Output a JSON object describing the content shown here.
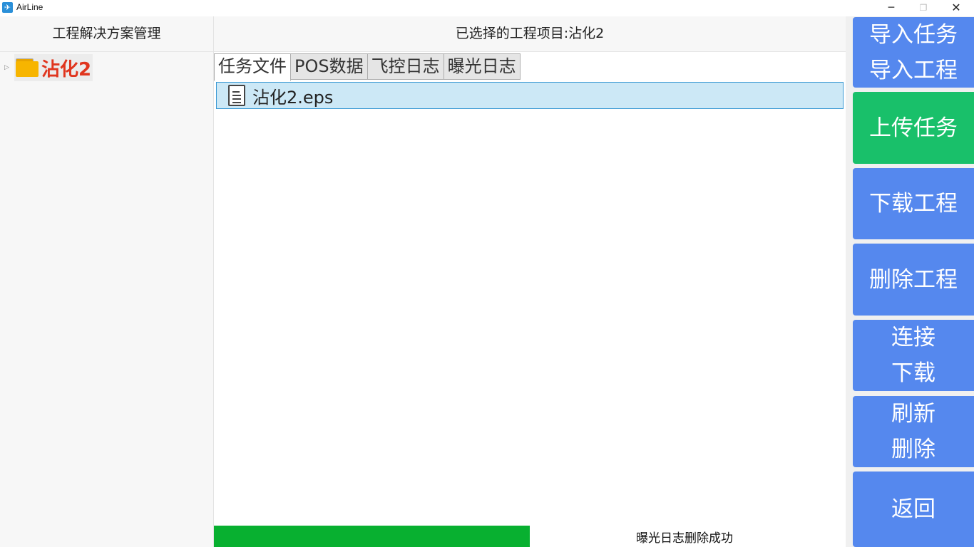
{
  "window": {
    "title": "AirLine",
    "minimize": "─",
    "maximize": "❐",
    "close": "✕"
  },
  "left": {
    "header": "工程解决方案管理",
    "tree": [
      {
        "label": "沾化2"
      }
    ]
  },
  "center": {
    "header": "已选择的工程项目:沾化2",
    "tabs": [
      {
        "label": "任务文件",
        "active": true
      },
      {
        "label": "POS数据",
        "active": false
      },
      {
        "label": "飞控日志",
        "active": false
      },
      {
        "label": "曝光日志",
        "active": false
      }
    ],
    "files": [
      {
        "name": "沾化2.eps"
      }
    ],
    "progress": 0.5,
    "status": "曝光日志删除成功"
  },
  "actions": [
    {
      "lines": [
        "导入任务",
        "导入工程"
      ],
      "color": "#5588ee"
    },
    {
      "lines": [
        "上传任务"
      ],
      "color": "#19c06a"
    },
    {
      "lines": [
        "下载工程"
      ],
      "color": "#5588ee"
    },
    {
      "lines": [
        "删除工程"
      ],
      "color": "#5588ee"
    },
    {
      "lines": [
        "连接",
        "下载"
      ],
      "color": "#5588ee"
    },
    {
      "lines": [
        "刷新",
        "删除"
      ],
      "color": "#5588ee"
    },
    {
      "lines": [
        "返回"
      ],
      "color": "#5588ee"
    }
  ],
  "colors": {
    "accent_blue": "#5588ee",
    "accent_green": "#19c06a",
    "progress_green": "#08b030",
    "tree_label_red": "#e0351e",
    "selection_bg": "#cce8f6"
  }
}
